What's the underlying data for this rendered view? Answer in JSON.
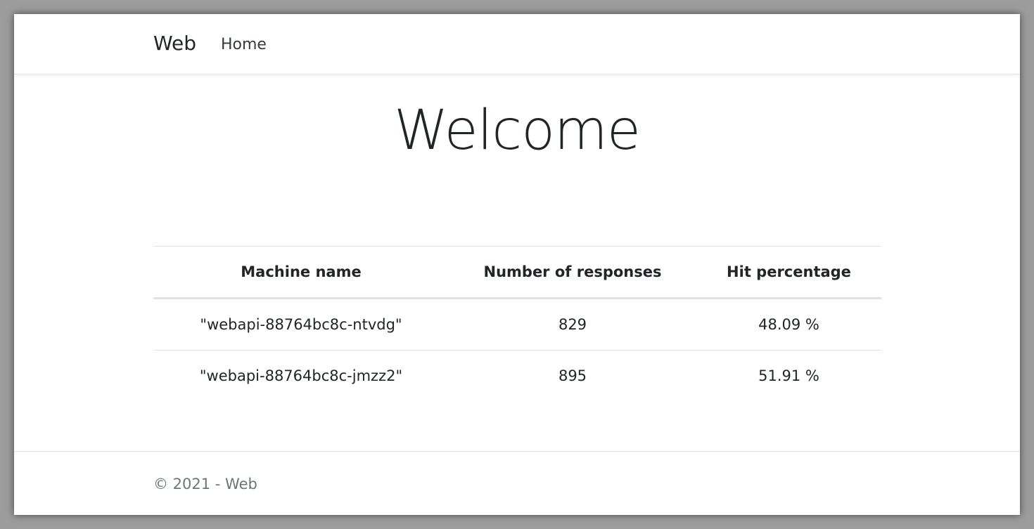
{
  "navbar": {
    "brand": "Web",
    "links": [
      {
        "label": "Home"
      }
    ]
  },
  "main": {
    "title": "Welcome",
    "table": {
      "headers": [
        "Machine name",
        "Number of responses",
        "Hit percentage"
      ],
      "rows": [
        {
          "machine": "\"webapi-88764bc8c-ntvdg\"",
          "responses": "829",
          "percentage": "48.09 %"
        },
        {
          "machine": "\"webapi-88764bc8c-jmzz2\"",
          "responses": "895",
          "percentage": "51.91 %"
        }
      ]
    }
  },
  "footer": {
    "text": "© 2021 - Web"
  },
  "colors": {
    "text": "#212529",
    "muted": "#6c757d",
    "border": "#dee2e6"
  }
}
